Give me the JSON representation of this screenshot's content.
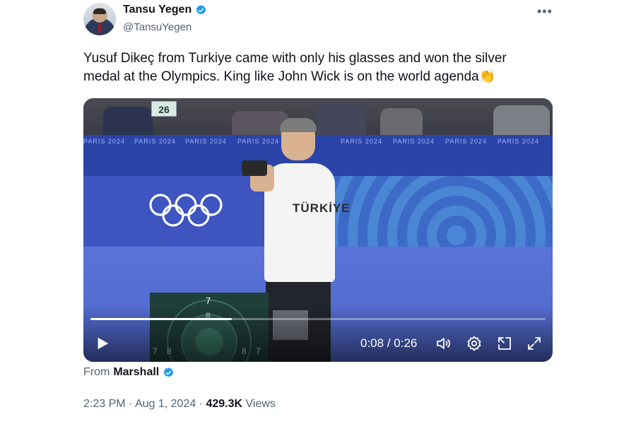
{
  "author": {
    "name": "Tansu Yegen",
    "handle": "@TansuYegen",
    "verified": true,
    "avatar_icon": "profile-photo"
  },
  "more_label": "•••",
  "tweet_text": {
    "line1": "Yusuf Dikeç from Turkiye came with only his glasses and won the silver",
    "line2": "medal at the Olympics. King like John Wick is on the world agenda",
    "emoji": "👏"
  },
  "video": {
    "scoreboard": "26",
    "banner_text": "PARIS 2024",
    "shirt_text": "TÜRKİYE",
    "target_numbers": {
      "top": "7",
      "second": "8",
      "left_a": "7",
      "left_b": "8",
      "right_a": "8",
      "right_b": "7"
    },
    "current_time": "0:08",
    "separator": " / ",
    "duration": "0:26",
    "progress_fraction": 0.31,
    "icons": [
      "play-icon",
      "volume-icon",
      "settings-icon",
      "pip-icon",
      "fullscreen-icon"
    ]
  },
  "attribution": {
    "prefix": "From",
    "source": "Marshall",
    "verified": true
  },
  "meta": {
    "time": "2:23 PM",
    "dot": " · ",
    "date": "Aug 1, 2024",
    "views_count": "429.3K",
    "views_label": "Views"
  },
  "colors": {
    "verified_blue": "#1d9bf0",
    "text_primary": "#0f1419",
    "text_secondary": "#536471"
  }
}
